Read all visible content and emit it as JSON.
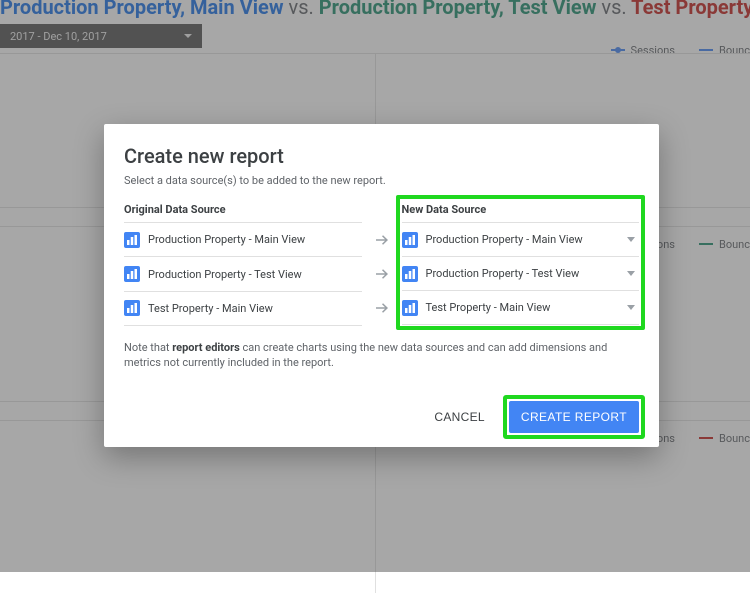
{
  "background": {
    "title": {
      "part1": "Production Property, Main View",
      "vs1": "vs.",
      "part2": "Production Property, Test View",
      "vs2": "vs.",
      "part3": "Test Property, Main View"
    },
    "date_range": "2017 - Dec 10, 2017",
    "legend": {
      "top": {
        "sessions": "Sessions",
        "bounce": "Bounc"
      },
      "mid": {
        "sessions": "ssions",
        "bounce": "Bounc"
      },
      "bot": {
        "sessions": "ssions",
        "bounce": "Bounc"
      }
    },
    "colors": {
      "top": "#4285f4",
      "mid": "#1e8e6e",
      "bot": "#c5221f"
    }
  },
  "dialog": {
    "title": "Create new report",
    "subtitle": "Select a data source(s) to be added to the new report.",
    "original_header": "Original Data Source",
    "new_header": "New Data Source",
    "note_prefix": "Note that ",
    "note_bold": "report editors",
    "note_suffix": " can create charts using the new data sources and can add dimensions and metrics not currently included in the report.",
    "sources": [
      {
        "original": "Production Property - Main View",
        "new": "Production Property - Main View"
      },
      {
        "original": "Production Property - Test View",
        "new": "Production Property - Test View"
      },
      {
        "original": "Test Property - Main View",
        "new": "Test Property - Main View"
      }
    ],
    "cancel": "CANCEL",
    "create": "CREATE REPORT"
  },
  "icons": {
    "data_source": "analytics-icon",
    "arrow": "arrow-right-icon"
  }
}
